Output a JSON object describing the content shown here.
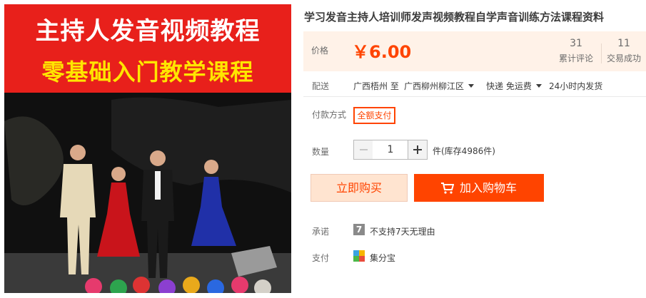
{
  "product": {
    "title": "学习发音主持人培训师发声视频教程自学声音训练方法课程资料",
    "image": {
      "banner_line1": "主持人发音视频教程",
      "banner_line2": "零基础入门教学课程"
    }
  },
  "price": {
    "label": "价格",
    "value": "￥6.00",
    "reviews_count": "31",
    "reviews_label": "累计评论",
    "sales_count": "11",
    "sales_label": "交易成功"
  },
  "shipping": {
    "label": "配送",
    "from": "广西梧州 至",
    "to": "广西柳州柳江区",
    "method": "快递 免运费",
    "dispatch": "24小时内发货"
  },
  "payment_method": {
    "label": "付款方式",
    "option": "全额支付"
  },
  "quantity": {
    "label": "数量",
    "value": "1",
    "minus": "−",
    "plus": "+",
    "stock": "件(库存4986件)"
  },
  "actions": {
    "buy_now": "立即购买",
    "add_to_cart": "加入购物车"
  },
  "promise": {
    "label": "承诺",
    "icon_glyph": "7",
    "text": "不支持7天无理由"
  },
  "pay": {
    "label": "支付",
    "text": "集分宝"
  },
  "colors": {
    "accent": "#ff4400",
    "price_bg": "#fff2e8",
    "banner_red": "#e8201b",
    "banner_yellow": "#ffe500"
  }
}
